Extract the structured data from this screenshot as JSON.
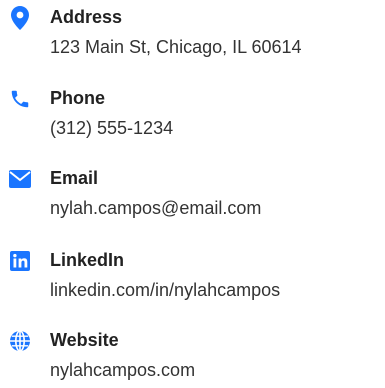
{
  "accent_color": "#1a75ff",
  "contacts": [
    {
      "label": "Address",
      "value": "123 Main St, Chicago, IL 60614",
      "icon": "map-marker-icon"
    },
    {
      "label": "Phone",
      "value": "(312) 555-1234",
      "icon": "phone-icon"
    },
    {
      "label": "Email",
      "value": "nylah.campos@email.com",
      "icon": "envelope-icon"
    },
    {
      "label": "LinkedIn",
      "value": "linkedin.com/in/nylahcampos",
      "icon": "linkedin-icon"
    },
    {
      "label": "Website",
      "value": "nylahcampos.com",
      "icon": "globe-icon"
    }
  ]
}
